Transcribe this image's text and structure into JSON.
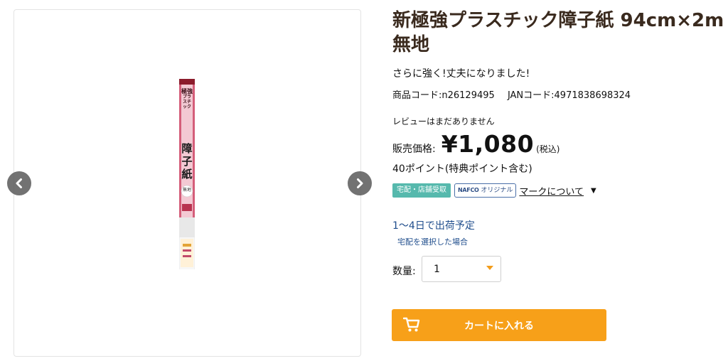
{
  "product": {
    "title": "新極強プラスチック障子紙 94cm×2m 無地",
    "catch_copy": "さらに強く!丈夫になりました!",
    "product_code": "商品コード:n26129495",
    "jan_code": "JANコード:4971838698324",
    "review_text": "レビューはまだありません",
    "price_label": "販売価格:",
    "price_value": "¥1,080",
    "price_tax": "(税込)",
    "points": "40ポイント(特典ポイント含む)",
    "badges": {
      "delivery": "宅配・店舗受取",
      "nafco_brand": "NAFCO",
      "nafco_suffix": "オリジナル",
      "mark_link": "マークについて"
    },
    "shipping": {
      "estimate": "1〜4日で出荷予定",
      "note": "宅配を選択した場合"
    },
    "quantity": {
      "label": "数量:",
      "value": "1"
    },
    "cart_button": "カートに入れる"
  },
  "packaging": {
    "brand_lines": [
      "極強",
      "プラスチック"
    ],
    "main_text": "障子紙",
    "sub_text": "無地"
  },
  "icons": {
    "prev": "chevron-left-icon",
    "next": "chevron-right-icon",
    "dropdown": "caret-down-icon",
    "cart": "cart-icon"
  },
  "colors": {
    "title": "#3a2a1e",
    "delivery_badge": "#56b9ad",
    "shipping_text": "#1f4d8c",
    "cart_button": "#f7a019"
  }
}
